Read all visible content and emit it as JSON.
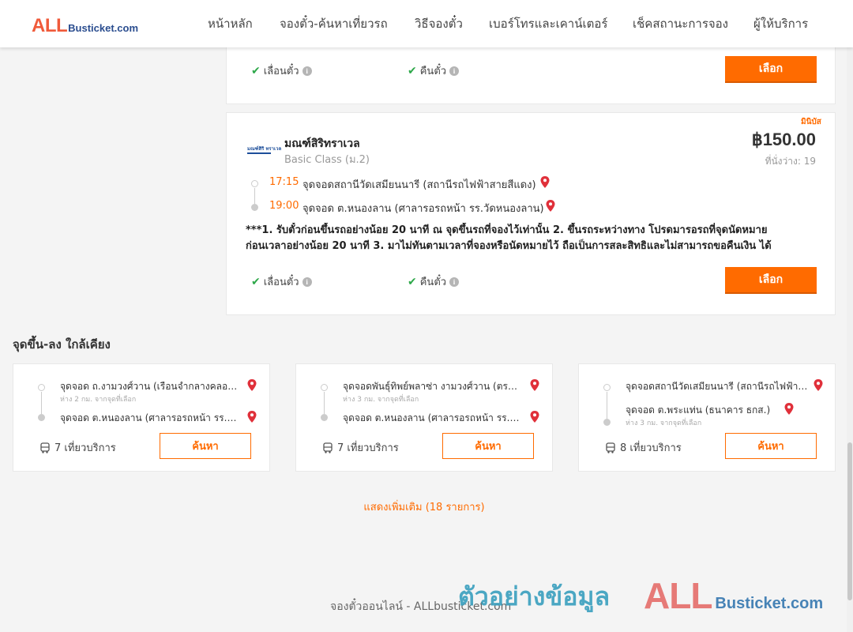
{
  "header": {
    "logo_all": "ALL",
    "logo_rest": "Busticket.com",
    "nav": [
      "หน้าหลัก",
      "จองตั๋ว-ค้นหาเที่ยวรถ",
      "วิธีจองตั๋ว",
      "เบอร์โทรและเคาน์เตอร์",
      "เช็คสถานะการจอง",
      "ผู้ให้บริการ"
    ]
  },
  "trip_top": {
    "reschedule_label": "เลื่อนตั๋ว",
    "refund_label": "คืนตั๋ว",
    "select_label": "เลือก"
  },
  "trip": {
    "badge": "มินิบัส",
    "logo_text": "มณฑ์สิริ ทราเวล",
    "operator": "มณฑ์สิริทราเวล",
    "class": "Basic Class (ม.2)",
    "price": "฿150.00",
    "seats": "ที่นั่งว่าง: 19",
    "depart_time": "17:15",
    "depart_stop": "จุดจอดสถานีวัดเสมียนนารี (สถานีรถไฟฟ้าสายสีแดง)",
    "arrive_time": "19:00",
    "arrive_stop": "จุดจอด ต.หนองลาน (ศาลารอรถหน้า รร.วัดหนองลาน)",
    "note_line1": "***1. รับตั๋วก่อนขึ้นรถอย่างน้อย 20 นาที ณ จุดขึ้นรถที่จองไว้เท่านั้น 2. ขึ้นรถระหว่างทาง โปรดมารอรถที่จุดนัดหมาย",
    "note_line2": "ก่อนเวลาอย่างน้อย 20 นาที 3. มาไม่ทันตามเวลาที่จองหรือนัดหมายไว้ ถือเป็นการสละสิทธิและไม่สามารถขอคืนเงิน ได้",
    "reschedule_label": "เลื่อนตั๋ว",
    "refund_label": "คืนตั๋ว",
    "select_label": "เลือก"
  },
  "nearby": {
    "title": "จุดขึ้น-ลง ใกล้เคียง",
    "cards": [
      {
        "from": "จุดจอด ถ.งามวงศ์วาน (เรือนจำกลางคลองเปรม)",
        "from_sub": "ห่าง 2 กม. จากจุดที่เลือก",
        "to": "จุดจอด ต.หนองลาน (ศาลารอรถหน้า รร.วัดหนองลาน)",
        "to_sub": "",
        "trips": "7 เที่ยวบริการ",
        "button": "ค้นหา"
      },
      {
        "from": "จุดจอดพันธุ์ทิพย์พลาซ่า งามวงศ์วาน (ตรงข้าม)",
        "from_sub": "ห่าง 3 กม. จากจุดที่เลือก",
        "to": "จุดจอด ต.หนองลาน (ศาลารอรถหน้า รร.วัดหนองลาน)",
        "to_sub": "",
        "trips": "7 เที่ยวบริการ",
        "button": "ค้นหา"
      },
      {
        "from": "จุดจอดสถานีวัดเสมียนนารี (สถานีรถไฟฟ้าสายสีแดง)",
        "from_sub": "",
        "to": "จุดจอด ต.พระแท่น (ธนาคาร ธกส.)",
        "to_sub": "ห่าง 3 กม. จากจุดที่เลือก",
        "trips": "8 เที่ยวบริการ",
        "button": "ค้นหา"
      }
    ]
  },
  "show_more": "แสดงเพิ่มเติม (18 รายการ)",
  "footer": "จองตั๋วออนไลน์ - ALLbusticket.com",
  "watermark": {
    "text": "ตัวอย่างข้อมูล",
    "logo_all": "ALL",
    "logo_rest": "Busticket.com"
  },
  "colors": {
    "accent": "#ff6b00",
    "check": "#2ea84a",
    "pin": "#e0303a",
    "logo_red": "#f05a3a",
    "logo_blue": "#2a4d8f"
  }
}
